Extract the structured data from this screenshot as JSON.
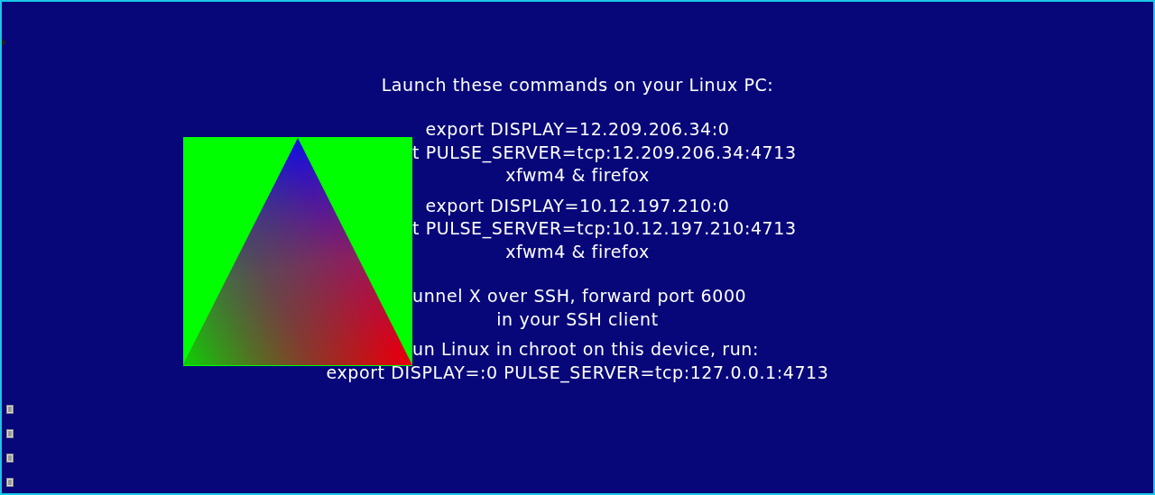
{
  "heading": "Launch these commands on your Linux PC:",
  "groups": [
    {
      "lines": [
        {
          "text": "export DISPLAY=12.209.206.34:0",
          "clipped": false
        },
        {
          "text": "t PULSE_SERVER=tcp:12.209.206.34:4713",
          "clipped": true
        },
        {
          "text": "xfwm4 & firefox",
          "clipped": false
        }
      ]
    },
    {
      "lines": [
        {
          "text": "export DISPLAY=10.12.197.210:0",
          "clipped": false
        },
        {
          "text": "t PULSE_SERVER=tcp:10.12.197.210:4713",
          "clipped": true
        },
        {
          "text": "xfwm4 & firefox",
          "clipped": false
        }
      ]
    },
    {
      "lines": [
        {
          "text": "unnel X over SSH, forward port 6000",
          "clipped": true
        },
        {
          "text": "in your SSH client",
          "clipped": false
        }
      ]
    },
    {
      "lines": [
        {
          "text": "un Linux in chroot on this device, run:",
          "clipped": true
        },
        {
          "text": "export DISPLAY=:0 PULSE_SERVER=tcp:127.0.0.1:4713",
          "clipped": false
        }
      ]
    }
  ]
}
